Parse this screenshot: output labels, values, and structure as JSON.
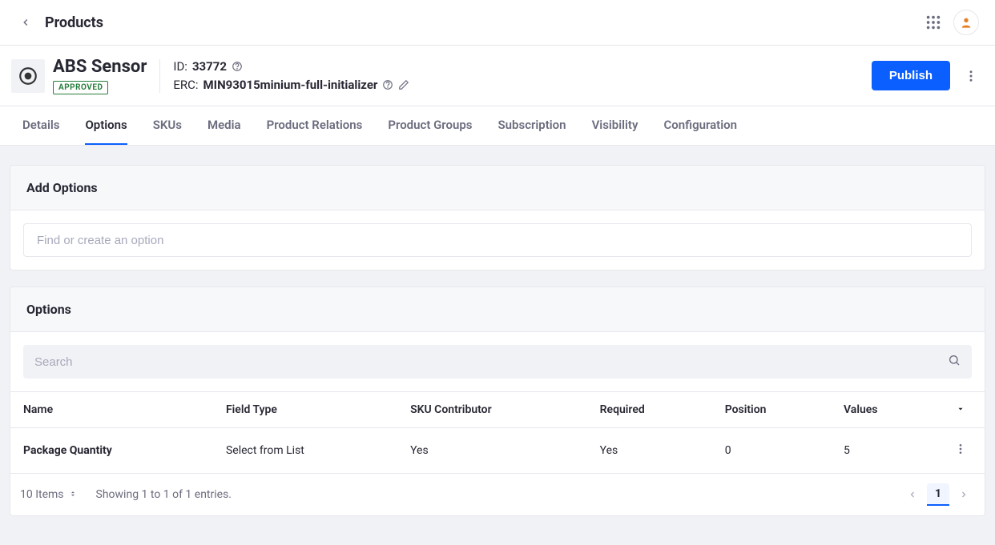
{
  "header": {
    "breadcrumb": "Products"
  },
  "product": {
    "name": "ABS Sensor",
    "status": "APPROVED",
    "id_label": "ID:",
    "id": "33772",
    "erc_label": "ERC:",
    "erc": "MIN93015minium-full-initializer",
    "publish": "Publish"
  },
  "tabs": [
    {
      "label": "Details",
      "active": false
    },
    {
      "label": "Options",
      "active": true
    },
    {
      "label": "SKUs",
      "active": false
    },
    {
      "label": "Media",
      "active": false
    },
    {
      "label": "Product Relations",
      "active": false
    },
    {
      "label": "Product Groups",
      "active": false
    },
    {
      "label": "Subscription",
      "active": false
    },
    {
      "label": "Visibility",
      "active": false
    },
    {
      "label": "Configuration",
      "active": false
    }
  ],
  "add_options": {
    "title": "Add Options",
    "placeholder": "Find or create an option"
  },
  "options_panel": {
    "title": "Options",
    "search_placeholder": "Search",
    "columns": {
      "name": "Name",
      "field_type": "Field Type",
      "sku_contrib": "SKU Contributor",
      "required": "Required",
      "position": "Position",
      "values": "Values"
    },
    "rows": [
      {
        "name": "Package Quantity",
        "field_type": "Select from List",
        "sku_contrib": "Yes",
        "required": "Yes",
        "position": "0",
        "values": "5"
      }
    ],
    "footer": {
      "per_page": "10 Items",
      "info": "Showing 1 to 1 of 1 entries.",
      "page": "1"
    }
  }
}
